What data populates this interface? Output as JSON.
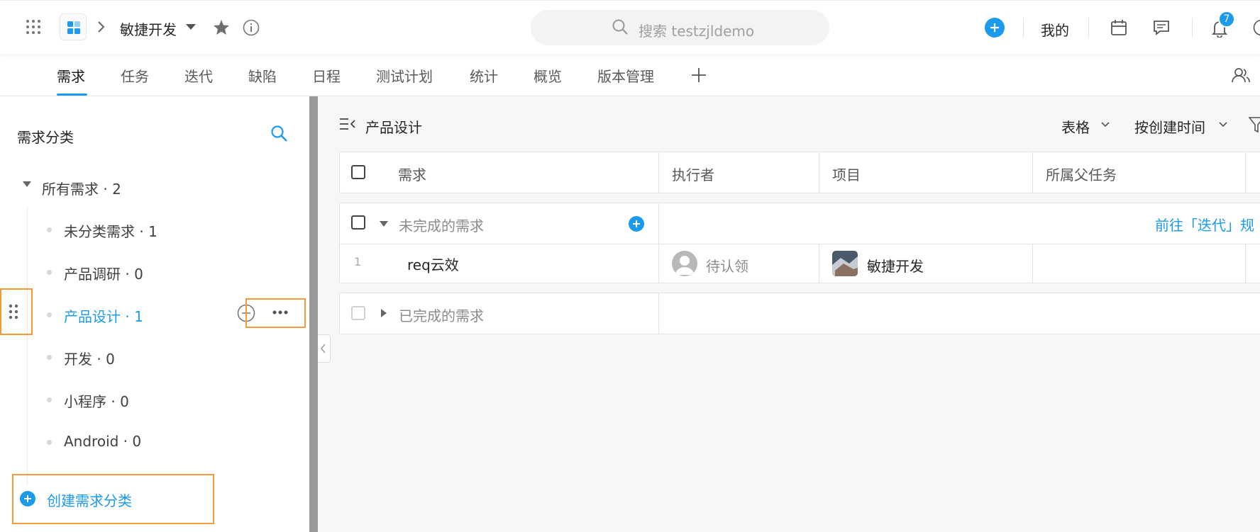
{
  "header": {
    "project_name": "敏捷开发",
    "search_placeholder": "搜索 testzjldemo",
    "mine_label": "我的",
    "notification_count": "7"
  },
  "tabs": [
    "需求",
    "任务",
    "迭代",
    "缺陷",
    "日程",
    "测试计划",
    "统计",
    "概览",
    "版本管理"
  ],
  "sidebar": {
    "title": "需求分类",
    "root_label": "所有需求 · 2",
    "items": [
      "未分类需求 · 1",
      "产品调研 · 0",
      "产品设计 · 1",
      "开发 · 0",
      "小程序 · 0",
      "Android · 0"
    ],
    "create_label": "创建需求分类"
  },
  "main": {
    "breadcrumb": "产品设计",
    "view_mode": "表格",
    "sort_label": "按创建时间",
    "columns": [
      "需求",
      "执行者",
      "项目",
      "所属父任务"
    ],
    "group_incomplete": "未完成的需求",
    "group_link": "前往「迭代」规",
    "group_complete": "已完成的需求",
    "row": {
      "index": "1",
      "title": "req云效",
      "assignee": "待认领",
      "project": "敏捷开发"
    }
  },
  "colors": {
    "accent": "#1b9aee",
    "highlight_border": "#f79a3a"
  }
}
